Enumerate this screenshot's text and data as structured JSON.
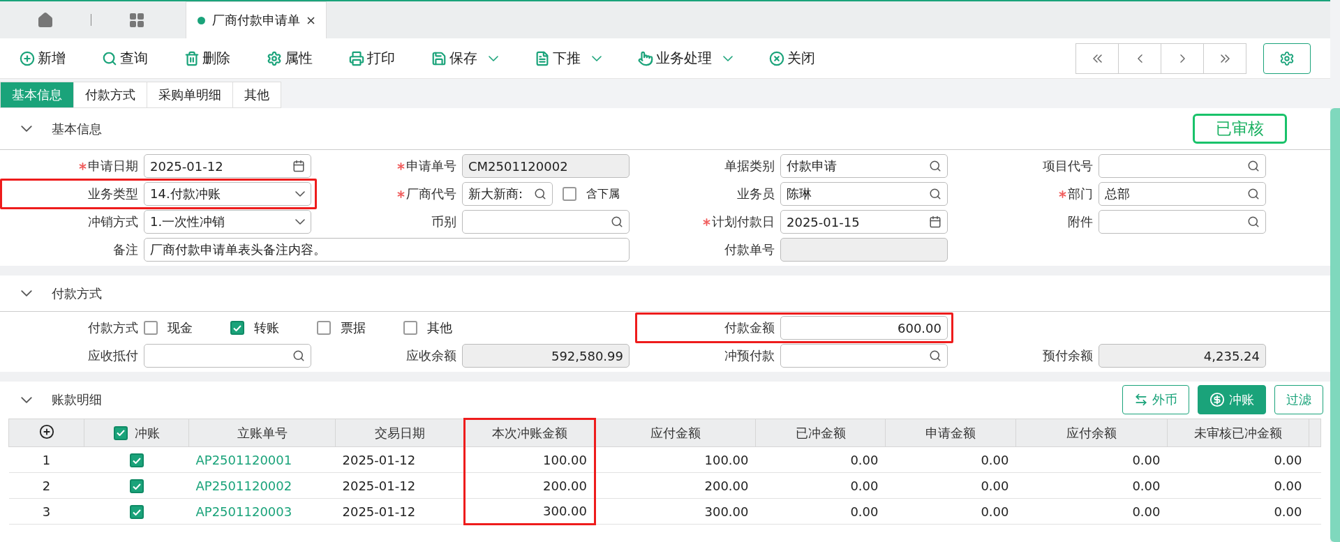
{
  "top_tabs": [
    {
      "label": "厂商付款申请单",
      "selected": true
    }
  ],
  "toolbar": [
    {
      "label": "新增",
      "has_menu": false
    },
    {
      "label": "查询",
      "has_menu": false
    },
    {
      "label": "删除",
      "has_menu": false
    },
    {
      "label": "属性",
      "has_menu": false
    },
    {
      "label": "打印",
      "has_menu": false
    },
    {
      "label": "保存",
      "has_menu": true
    },
    {
      "label": "下推",
      "has_menu": true
    },
    {
      "label": "业务处理",
      "has_menu": true
    },
    {
      "label": "关闭",
      "has_menu": false
    }
  ],
  "form_tabs": [
    {
      "label": "基本信息",
      "selected": true
    },
    {
      "label": "付款方式",
      "selected": false
    },
    {
      "label": "采购单明细",
      "selected": false
    },
    {
      "label": "其他",
      "selected": false
    }
  ],
  "basic_section": {
    "title": "基本信息",
    "expanded": true,
    "status": "已审核",
    "rows": [
      [
        {
          "label": "申请日期",
          "required": true,
          "kind": "date",
          "value": "2025-01-12",
          "highlighted": false
        },
        {
          "label": "申请单号",
          "required": true,
          "kind": "readonly",
          "value": "CM2501120002",
          "highlighted": false
        },
        {
          "label": "单据类别",
          "required": false,
          "kind": "lookup",
          "value": "付款申请",
          "highlighted": false
        },
        {
          "label": "项目代号",
          "required": false,
          "kind": "lookup",
          "highlighted": false
        }
      ],
      [
        {
          "label": "业务类型",
          "required": false,
          "kind": "select",
          "value": "14.付款冲账",
          "highlighted": true
        },
        {
          "label": "厂商代号",
          "required": true,
          "kind": "lookup",
          "value": "新大新商:",
          "highlighted": false,
          "sub_checkbox": {
            "label": "含下属",
            "checked": false
          }
        },
        {
          "label": "业务员",
          "required": false,
          "kind": "lookup",
          "value": "陈琳",
          "highlighted": false
        },
        {
          "label": "部门",
          "required": true,
          "kind": "lookup",
          "value": "总部",
          "highlighted": false
        }
      ],
      [
        {
          "label": "冲销方式",
          "required": false,
          "kind": "select",
          "value": "1.一次性冲销",
          "highlighted": false
        },
        {
          "label": "币别",
          "required": false,
          "kind": "lookup",
          "highlighted": false
        },
        {
          "label": "计划付款日",
          "required": true,
          "kind": "date",
          "value": "2025-01-15",
          "highlighted": false
        },
        {
          "label": "附件",
          "required": false,
          "kind": "lookup",
          "highlighted": false
        }
      ],
      [
        {
          "label": "备注",
          "required": false,
          "kind": "wide",
          "value": "厂商付款申请单表头备注内容。",
          "highlighted": false
        },
        "",
        {
          "label": "付款单号",
          "required": false,
          "kind": "readonly",
          "highlighted": false
        }
      ]
    ]
  },
  "payment_section": {
    "title": "付款方式",
    "expanded": true,
    "rows": [
      [
        {
          "label": "付款方式",
          "required": false,
          "kind": "checks",
          "highlighted": false,
          "options": [
            {
              "label": "现金",
              "checked": false
            },
            {
              "label": "转账",
              "checked": true
            },
            {
              "label": "票据",
              "checked": false
            },
            {
              "label": "其他",
              "checked": false
            }
          ]
        },
        "",
        {
          "label": "付款金额",
          "required": false,
          "kind": "number",
          "value": "600.00",
          "highlighted": true
        }
      ],
      [
        {
          "label": "应收抵付",
          "required": false,
          "kind": "lookup",
          "highlighted": false
        },
        {
          "label": "应收余额",
          "required": false,
          "kind": "readonly_number",
          "value": "592,580.99",
          "highlighted": false
        },
        {
          "label": "冲预付款",
          "required": false,
          "kind": "lookup",
          "highlighted": false
        },
        {
          "label": "预付余额",
          "required": false,
          "kind": "readonly_number",
          "value": "4,235.24",
          "highlighted": false
        }
      ]
    ]
  },
  "detail_section": {
    "title": "账款明细",
    "expanded": true,
    "buttons": [
      {
        "label": "外币",
        "primary": false,
        "kind": "swap"
      },
      {
        "label": "冲账",
        "primary": true,
        "kind": "dollar"
      },
      {
        "label": "过滤",
        "primary": false,
        "kind": "plain"
      }
    ],
    "table": {
      "check_header": {
        "label": "冲账",
        "checked": true
      },
      "columns": [
        {
          "kind": "link",
          "label": "立账单号",
          "highlighted": false
        },
        {
          "kind": "text",
          "label": "交易日期",
          "highlighted": false
        },
        {
          "kind": "number",
          "label": "本次冲账金额",
          "highlighted": true
        },
        {
          "kind": "number",
          "label": "应付金额",
          "highlighted": false
        },
        {
          "kind": "number",
          "label": "已冲金额",
          "highlighted": false
        },
        {
          "kind": "number",
          "label": "申请金额",
          "highlighted": false
        },
        {
          "kind": "number",
          "label": "应付余额",
          "highlighted": false
        },
        {
          "kind": "number",
          "label": "未审核已冲金额",
          "highlighted": false
        }
      ],
      "rows": [
        {
          "no": "1",
          "checked": true,
          "cells": [
            "AP2501120001",
            "2025-01-12",
            "100.00",
            "100.00",
            "0.00",
            "0.00",
            "0.00",
            "0.00"
          ]
        },
        {
          "no": "2",
          "checked": true,
          "cells": [
            "AP2501120002",
            "2025-01-12",
            "200.00",
            "200.00",
            "0.00",
            "0.00",
            "0.00",
            "0.00"
          ]
        },
        {
          "no": "3",
          "checked": true,
          "cells": [
            "AP2501120003",
            "2025-01-12",
            "300.00",
            "300.00",
            "0.00",
            "0.00",
            "0.00",
            "0.00"
          ]
        }
      ]
    }
  }
}
